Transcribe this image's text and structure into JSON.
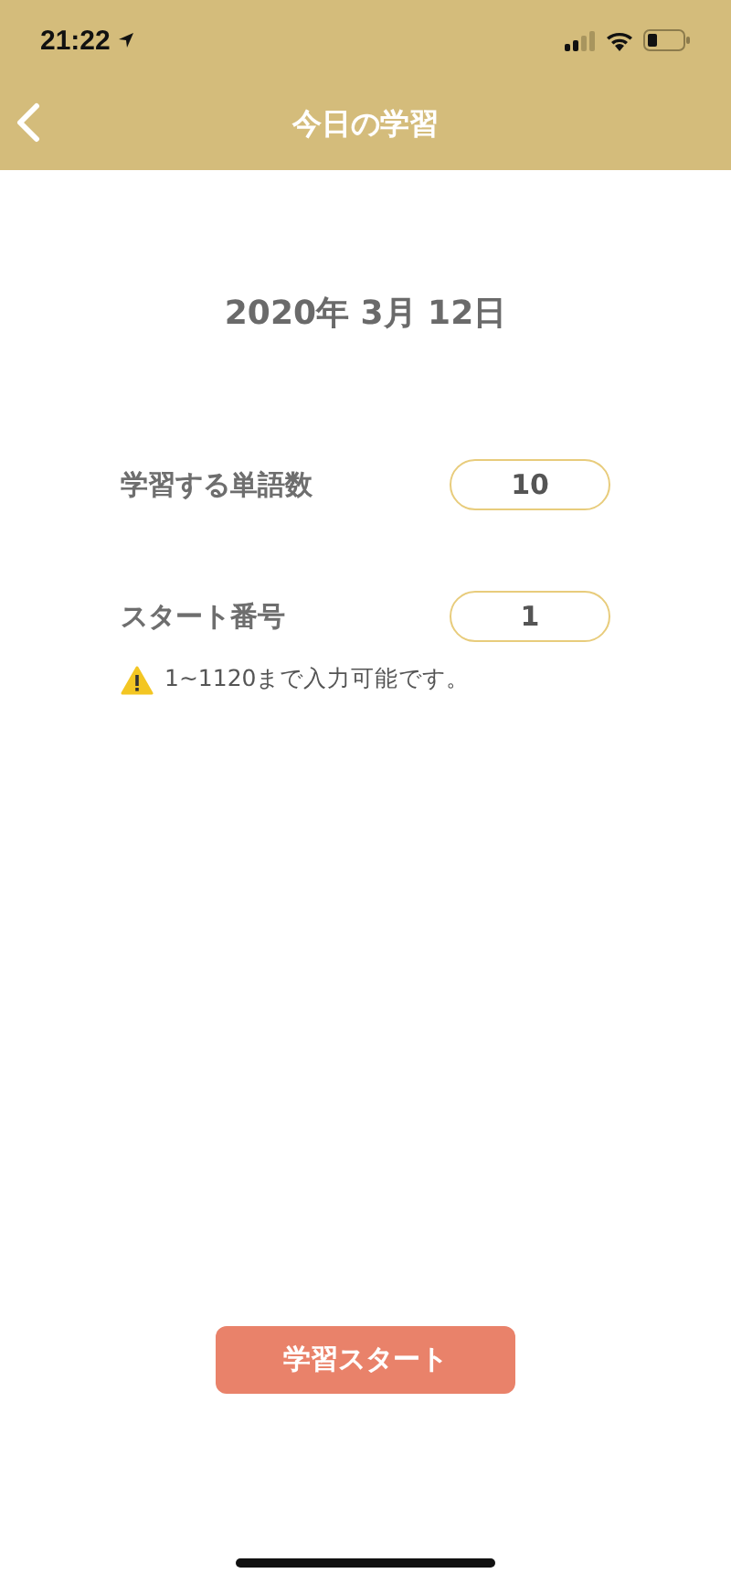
{
  "status_bar": {
    "time": "21:22"
  },
  "nav_bar": {
    "title": "今日の学習"
  },
  "date": "2020年 3月 12日",
  "fields": [
    {
      "label": "学習する単語数",
      "value": "10"
    },
    {
      "label": "スタート番号",
      "value": "1"
    }
  ],
  "note": "1~1120まで入力可能です。",
  "start_button": "学習スタート"
}
